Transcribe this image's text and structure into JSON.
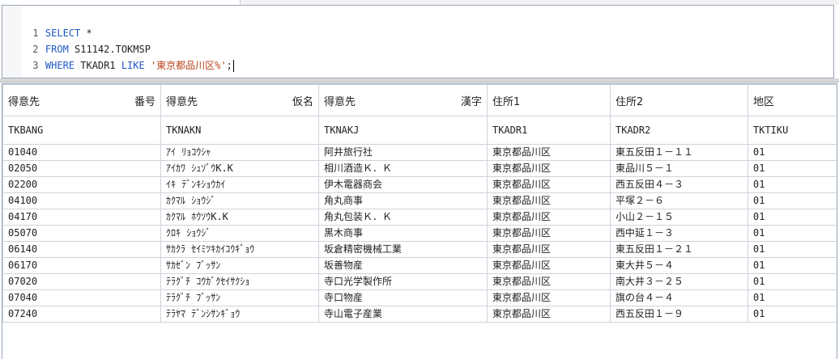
{
  "editor": {
    "lines": [
      {
        "num": "1",
        "keyword": "SELECT",
        "text": " *"
      },
      {
        "num": "2",
        "keyword": "FROM",
        "text": " S11142.TOKMSP"
      },
      {
        "num": "3",
        "keyword": "WHERE",
        "text": " TKADR1 ",
        "keyword2": "LIKE",
        "string": " '東京都品川区%'",
        "tail": ";"
      }
    ]
  },
  "grid": {
    "columns": [
      {
        "label": "得意先",
        "suffix": "番号",
        "field": "TKBANG"
      },
      {
        "label": "得意先",
        "suffix": "仮名",
        "field": "TKNAKN"
      },
      {
        "label": "得意先",
        "suffix": "漢字",
        "field": "TKNAKJ"
      },
      {
        "label": "住所1",
        "suffix": "",
        "field": "TKADR1"
      },
      {
        "label": "住所2",
        "suffix": "",
        "field": "TKADR2"
      },
      {
        "label": "地区",
        "suffix": "",
        "field": "TKTIKU"
      }
    ],
    "rows": [
      [
        "01040",
        "ｱｲ ﾘｮｺｳｼｬ",
        "阿井旅行社",
        "東京都品川区",
        "東五反田１－１１",
        "01"
      ],
      [
        "02050",
        "ｱｲｶﾜ ｼｭｿﾞｳK.K",
        "相川酒造Ｋ．Ｋ",
        "東京都品川区",
        "東品川５－１",
        "01"
      ],
      [
        "02200",
        "ｲｷ ﾃﾞﾝｷｼｮｳｶｲ",
        "伊木電器商会",
        "東京都品川区",
        "西五反田４－３",
        "01"
      ],
      [
        "04100",
        "ｶｸﾏﾙ ｼｮｳｼﾞ",
        "角丸商事",
        "東京都品川区",
        "平塚２－６",
        "01"
      ],
      [
        "04170",
        "ｶｸﾏﾙ ﾎｳｿｳK.K",
        "角丸包装Ｋ．Ｋ",
        "東京都品川区",
        "小山２－１５",
        "01"
      ],
      [
        "05070",
        "ｸﾛｷ ｼｮｳｼﾞ",
        "黒木商事",
        "東京都品川区",
        "西中延１－３",
        "01"
      ],
      [
        "06140",
        "ｻｶｸﾗ ｾｲﾐﾂｷｶｲｺｳｷﾞｮｳ",
        "坂倉精密機械工業",
        "東京都品川区",
        "東五反田１－２１",
        "01"
      ],
      [
        "06170",
        "ｻｶｾﾞﾝ ﾌﾞｯｻﾝ",
        "坂善物産",
        "東京都品川区",
        "東大井５－４",
        "01"
      ],
      [
        "07020",
        "ﾃﾗｸﾞﾁ ｺｳｶﾞｸｾｲｻｸｼｮ",
        "寺口光学製作所",
        "東京都品川区",
        "南大井３－２５",
        "01"
      ],
      [
        "07040",
        "ﾃﾗｸﾞﾁ ﾌﾞｯｻﾝ",
        "寺口物産",
        "東京都品川区",
        "旗の台４－４",
        "01"
      ],
      [
        "07240",
        "ﾃﾗﾔﾏ ﾃﾞﾝｼｻﾝｷﾞｮｳ",
        "寺山電子産業",
        "東京都品川区",
        "西五反田１－９",
        "01"
      ]
    ]
  }
}
